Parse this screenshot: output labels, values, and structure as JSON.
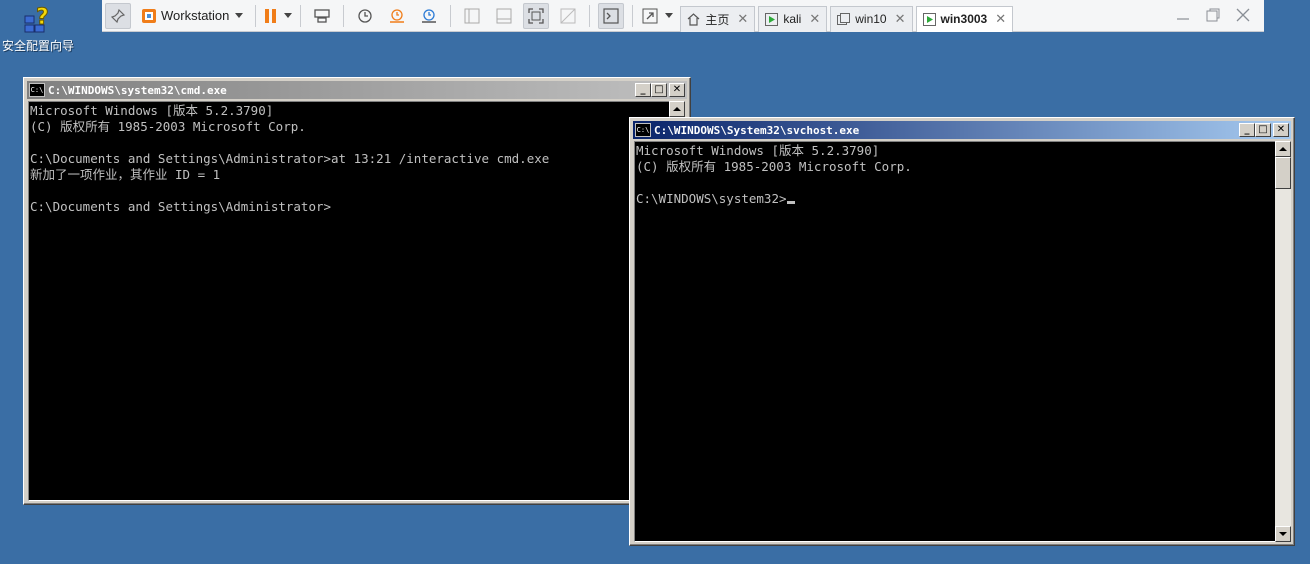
{
  "desktop": {
    "icon_label": "安全配置向导",
    "background_color": "#3a6ea5"
  },
  "vmware": {
    "workstation_label": "Workstation",
    "tabs": [
      {
        "label": "主页",
        "icon": "home-icon",
        "active": false
      },
      {
        "label": "kali",
        "icon": "vm-running-icon",
        "active": false
      },
      {
        "label": "win10",
        "icon": "vm-icon",
        "active": false
      },
      {
        "label": "win3003",
        "icon": "vm-running-icon",
        "active": true
      }
    ],
    "tab_close_glyph": "✕",
    "accent_color": "#f07d19"
  },
  "cmd_window": {
    "title": "C:\\WINDOWS\\system32\\cmd.exe",
    "icon_text": "C:\\",
    "lines": [
      "Microsoft Windows [版本 5.2.3790]",
      "(C) 版权所有 1985-2003 Microsoft Corp.",
      "",
      "C:\\Documents and Settings\\Administrator>at 13:21 /interactive cmd.exe",
      "新加了一项作业，其作业 ID = 1",
      "",
      "C:\\Documents and Settings\\Administrator>"
    ]
  },
  "svchost_window": {
    "title": "C:\\WINDOWS\\System32\\svchost.exe",
    "icon_text": "C:\\",
    "lines": [
      "Microsoft Windows [版本 5.2.3790]",
      "(C) 版权所有 1985-2003 Microsoft Corp.",
      "",
      "C:\\WINDOWS\\system32>"
    ]
  },
  "window_buttons": {
    "minimize": "_",
    "maximize": "□",
    "close": "✕"
  }
}
